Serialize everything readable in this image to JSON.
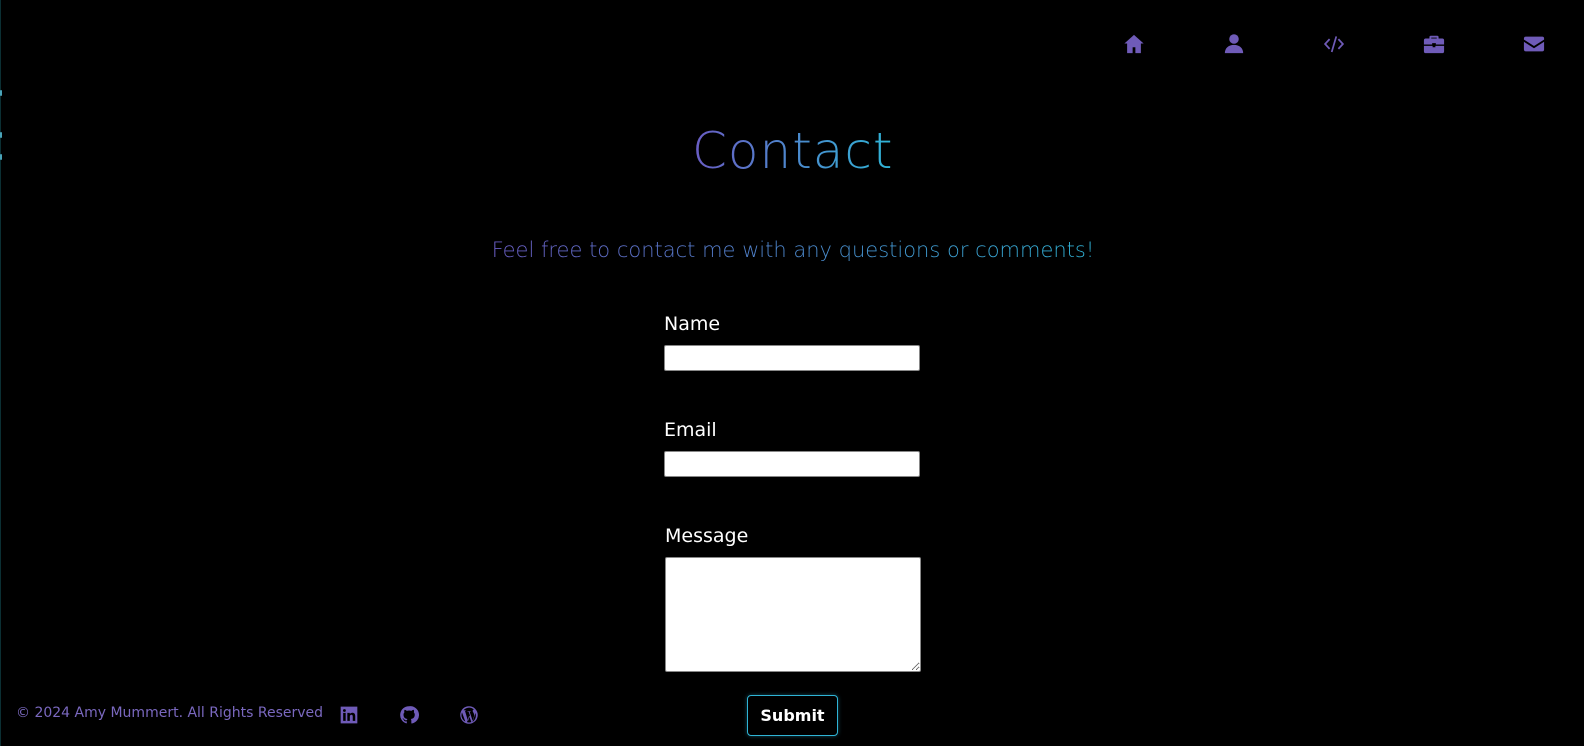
{
  "nav": {
    "items": [
      {
        "icon": "home-icon"
      },
      {
        "icon": "user-icon"
      },
      {
        "icon": "code-icon"
      },
      {
        "icon": "briefcase-icon"
      },
      {
        "icon": "envelope-icon"
      }
    ],
    "icon_color": "#6f5bb8"
  },
  "header": {
    "title": "Contact",
    "subtitle": "Feel free to contact me with any questions or comments!",
    "gradient_start": "#6a5cc4",
    "gradient_end": "#2fb4d6"
  },
  "form": {
    "name_label": "Name",
    "name_value": "",
    "email_label": "Email",
    "email_value": "",
    "message_label": "Message",
    "message_value": "",
    "submit_label": "Submit"
  },
  "footer": {
    "copyright": "© 2024 Amy Mummert. All Rights Reserved",
    "social": [
      {
        "icon": "linkedin-icon"
      },
      {
        "icon": "github-icon"
      },
      {
        "icon": "wordpress-icon"
      }
    ]
  }
}
